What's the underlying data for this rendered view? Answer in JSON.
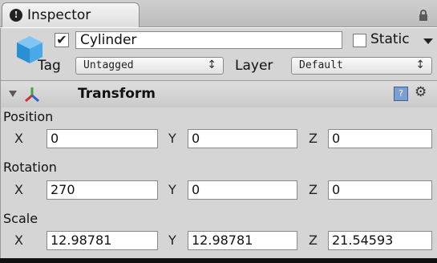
{
  "window": {
    "tab_title": "Inspector",
    "info_glyph": "!"
  },
  "game_object": {
    "active": true,
    "name": "Cylinder",
    "static_label": "Static",
    "static_checked": false,
    "tag_label": "Tag",
    "tag_value": "Untagged",
    "layer_label": "Layer",
    "layer_value": "Default",
    "select_arrows": "↕"
  },
  "component": {
    "title": "Transform",
    "help_glyph": "?",
    "gear_glyph": "⚙"
  },
  "transform": {
    "position": {
      "label": "Position",
      "x": "0",
      "y": "0",
      "z": "0"
    },
    "rotation": {
      "label": "Rotation",
      "x": "270",
      "y": "0",
      "z": "0"
    },
    "scale": {
      "label": "Scale",
      "x": "12.98781",
      "y": "12.98781",
      "z": "21.54593"
    }
  },
  "axes": {
    "x": "X",
    "y": "Y",
    "z": "Z"
  },
  "colors": {
    "panel_bg": "#d5d5d5",
    "cube_icon": "#4aa8e8",
    "help_icon": "#7b9fd3"
  }
}
